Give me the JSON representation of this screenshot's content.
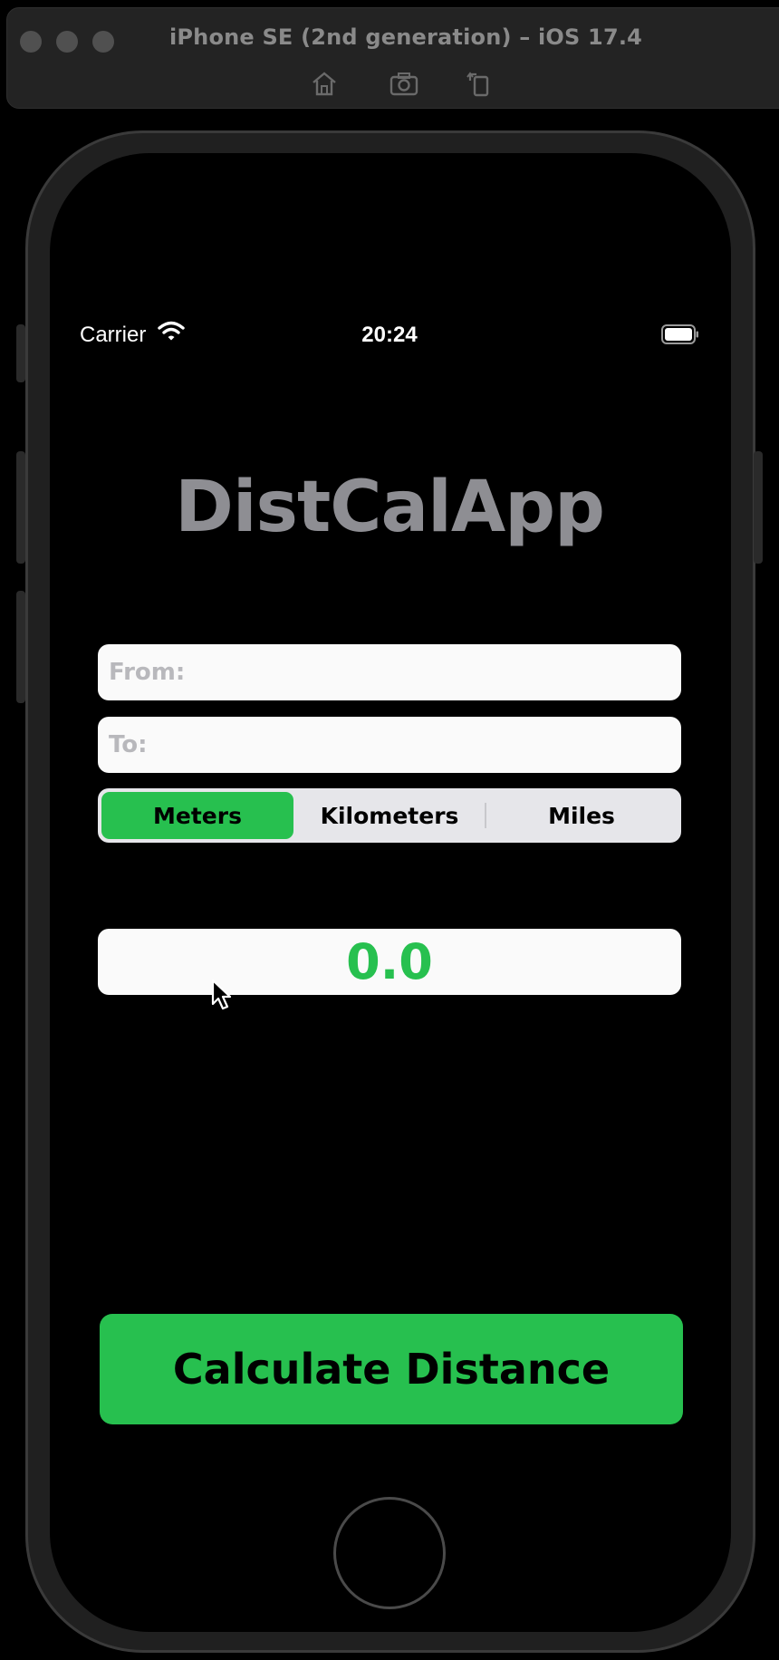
{
  "simulator": {
    "title": "iPhone SE (2nd generation) – iOS 17.4",
    "tools": [
      "home-icon",
      "screenshot-icon",
      "rotate-icon"
    ]
  },
  "status_bar": {
    "carrier": "Carrier",
    "time": "20:24"
  },
  "app": {
    "title": "DistCalApp",
    "from_placeholder": "From:",
    "to_placeholder": "To:",
    "units": [
      {
        "label": "Meters",
        "selected": true
      },
      {
        "label": "Kilometers",
        "selected": false
      },
      {
        "label": "Miles",
        "selected": false
      }
    ],
    "result": "0.0",
    "calculate_label": "Calculate Distance"
  },
  "colors": {
    "accent": "#27c04f",
    "title_gray": "#8e8e93",
    "field_bg": "#fafafa",
    "segment_bg": "#e6e6ea"
  }
}
